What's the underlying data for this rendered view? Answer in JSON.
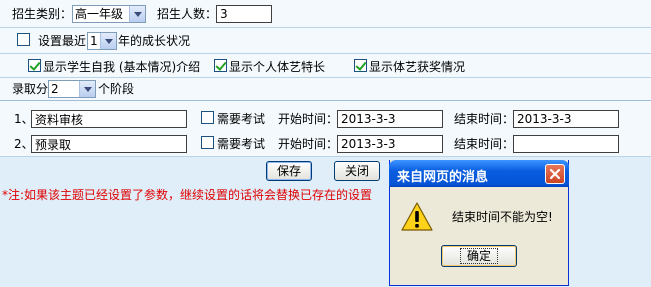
{
  "row1": {
    "category_label": "招生类别：",
    "category_value": "高一年级",
    "count_label": "招生人数：",
    "count_value": "3"
  },
  "row2": {
    "prefix": "设置最近",
    "years_value": "1",
    "suffix": "年的成长状况"
  },
  "row3": {
    "opt1": "显示学生自我 (基本情况)介绍",
    "opt2": "显示个人体艺特长",
    "opt3": "显示体艺获奖情况"
  },
  "row4": {
    "prefix": "录取分",
    "stages_value": "2",
    "suffix": "个阶段"
  },
  "stages": [
    {
      "index": "1、",
      "name": "资料审核",
      "exam_label": "需要考试",
      "start_label": "开始时间：",
      "start_value": "2013-3-3",
      "end_label": "结束时间：",
      "end_value": "2013-3-3"
    },
    {
      "index": "2、",
      "name": "预录取",
      "exam_label": "需要考试",
      "start_label": "开始时间：",
      "start_value": "2013-3-3",
      "end_label": "结束时间：",
      "end_value": ""
    }
  ],
  "buttons": {
    "save": "保存",
    "close": "关闭"
  },
  "note": "*注:如果该主题已经设置了参数，继续设置的话将会替换已存在的设置",
  "dialog": {
    "title": "来自网页的消息",
    "message": "结束时间不能为空!",
    "ok": "确定"
  },
  "icons": {
    "dialog_icon": "warning-icon",
    "dialog_close": "close-icon"
  },
  "colors": {
    "note": "#e00000",
    "title_bar": "#0553d6",
    "close_button": "#cc4424"
  }
}
